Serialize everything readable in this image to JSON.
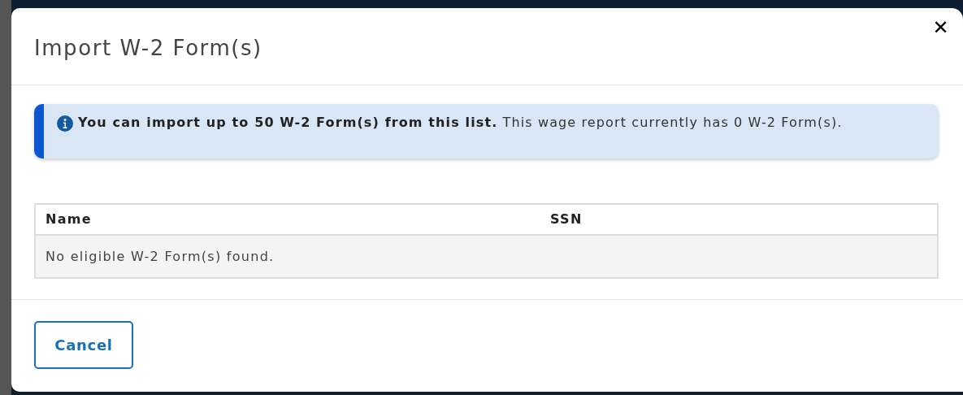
{
  "dialog": {
    "title": "Import W-2 Form(s)",
    "close": "✕"
  },
  "alert": {
    "text": "**You can import up to 50 W-2 Form(s) from this list.** This wage report currently has 0 W-2 Form(s)."
  },
  "table": {
    "columns": [
      "Name",
      "SSN"
    ],
    "empty_message": "No eligible W-2 Form(s) found."
  },
  "buttons": [
    "Cancel"
  ]
}
